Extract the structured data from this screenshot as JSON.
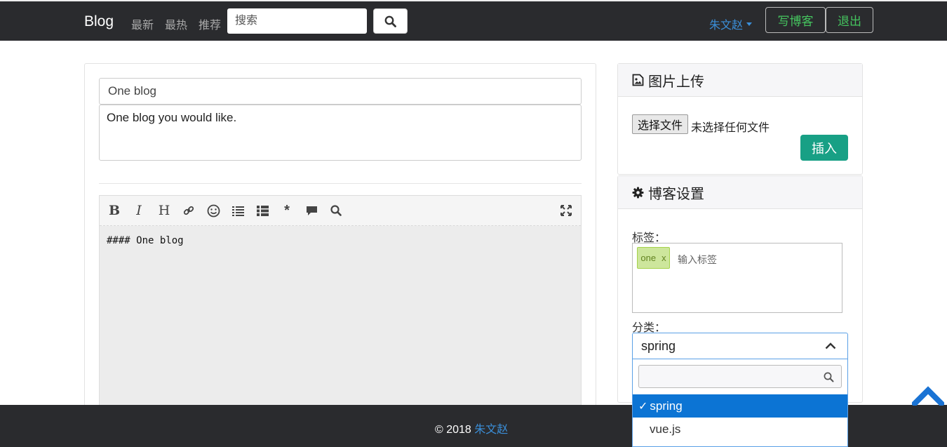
{
  "navbar": {
    "brand": "Blog",
    "links": [
      "最新",
      "最热",
      "推荐"
    ],
    "search_placeholder": "搜索",
    "user_name": "朱文赵",
    "write_button": "写博客",
    "logout_button": "退出"
  },
  "editor_panel": {
    "title_value": "One blog",
    "description_value": "One blog you would like.",
    "toolbar_tools": [
      "bold",
      "italic",
      "heading",
      "link",
      "emoji",
      "list-ordered",
      "list-unordered",
      "asterisk",
      "comment",
      "search",
      "fullscreen"
    ],
    "content": "#### One blog"
  },
  "image_upload": {
    "header": "图片上传",
    "file_button": "选择文件",
    "file_status": "未选择任何文件",
    "insert_button": "插入"
  },
  "blog_settings": {
    "header": "博客设置",
    "tags_label": "标签：",
    "tags": [
      {
        "name": "one",
        "remove": "x"
      }
    ],
    "tag_input_placeholder": "输入标签",
    "category_label": "分类：",
    "category_selected": "spring",
    "category_options": [
      "spring",
      "vue.js"
    ]
  },
  "footer": {
    "copyright": "© 2018",
    "author": "朱文赵"
  },
  "colors": {
    "navbar_bg": "#2a2b2e",
    "accent_green": "#45c45f",
    "insert_green": "#18a085",
    "link_blue": "#3b8fd9",
    "selected_blue": "#0c74d4"
  }
}
